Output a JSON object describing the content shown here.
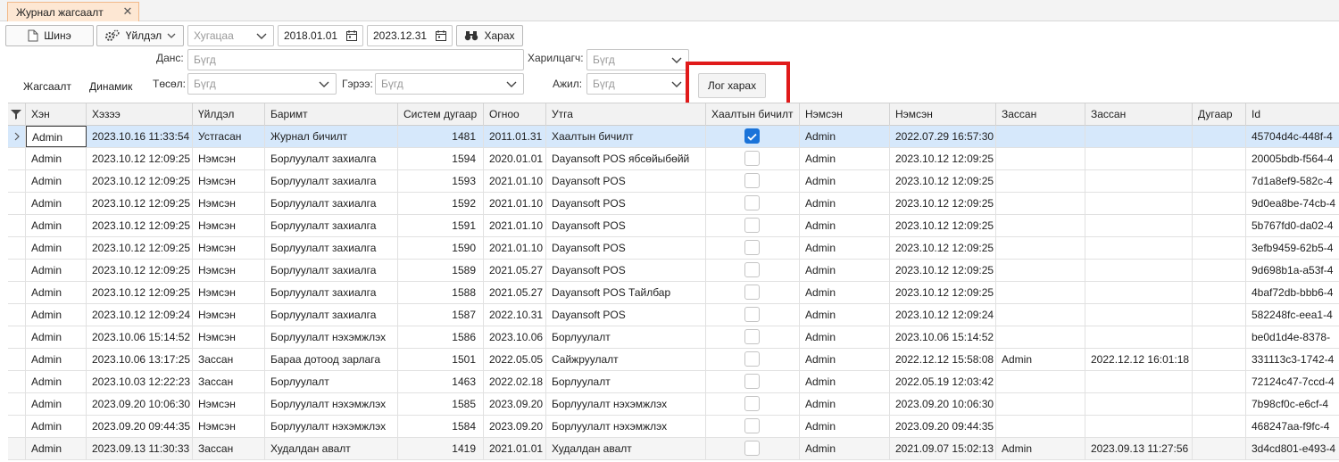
{
  "tab": {
    "title": "Журнал жагсаалт",
    "close": "✕"
  },
  "toolbar": {
    "new_label": "Шинэ",
    "action_label": "Үйлдэл",
    "period_placeholder": "Хугацаа",
    "date_from": "2018.01.01",
    "date_to": "2023.12.31",
    "view_label": "Харах"
  },
  "filters": {
    "account_label": "Данс:",
    "account_placeholder": "Бүгд",
    "partner_label": "Харилцагч:",
    "partner_placeholder": "Бүгд",
    "type_label": "Төсөл:",
    "type_placeholder": "Бүгд",
    "contract_label": "Гэрээ:",
    "contract_placeholder": "Бүгд",
    "job_label": "Ажил:",
    "job_placeholder": "Бүгд",
    "log_view_label": "Лог харах"
  },
  "view_tabs": {
    "list": "Жагсаалт",
    "dynamic": "Динамик"
  },
  "grid": {
    "columns": [
      "Хэн",
      "Хэзээ",
      "Үйлдэл",
      "Баримт",
      "Систем дугаар",
      "Огноо",
      "Утга",
      "Хаалтын бичилт",
      "Нэмсэн",
      "Нэмсэн",
      "Зассан",
      "Зассан",
      "Дугаар",
      "Id"
    ],
    "rows": [
      [
        "Admin",
        "2023.10.16 11:33:54",
        "Устгасан",
        "Журнал бичилт",
        "1481",
        "2011.01.31",
        "Хаалтын бичилт",
        true,
        "Admin",
        "2022.07.29 16:57:30",
        "",
        "",
        "",
        "45704d4c-448f-4"
      ],
      [
        "Admin",
        "2023.10.12 12:09:25",
        "Нэмсэн",
        "Борлуулалт захиалга",
        "1594",
        "2020.01.01",
        "Dayansoft POS ябсөйыбөйй",
        false,
        "Admin",
        "2023.10.12 12:09:25",
        "",
        "",
        "",
        "20005bdb-f564-4"
      ],
      [
        "Admin",
        "2023.10.12 12:09:25",
        "Нэмсэн",
        "Борлуулалт захиалга",
        "1593",
        "2021.01.10",
        "Dayansoft POS",
        false,
        "Admin",
        "2023.10.12 12:09:25",
        "",
        "",
        "",
        "7d1a8ef9-582c-4"
      ],
      [
        "Admin",
        "2023.10.12 12:09:25",
        "Нэмсэн",
        "Борлуулалт захиалга",
        "1592",
        "2021.01.10",
        "Dayansoft POS",
        false,
        "Admin",
        "2023.10.12 12:09:25",
        "",
        "",
        "",
        "9d0ea8be-74cb-4"
      ],
      [
        "Admin",
        "2023.10.12 12:09:25",
        "Нэмсэн",
        "Борлуулалт захиалга",
        "1591",
        "2021.01.10",
        "Dayansoft POS",
        false,
        "Admin",
        "2023.10.12 12:09:25",
        "",
        "",
        "",
        "5b767fd0-da02-4"
      ],
      [
        "Admin",
        "2023.10.12 12:09:25",
        "Нэмсэн",
        "Борлуулалт захиалга",
        "1590",
        "2021.01.10",
        "Dayansoft POS",
        false,
        "Admin",
        "2023.10.12 12:09:25",
        "",
        "",
        "",
        "3efb9459-62b5-4"
      ],
      [
        "Admin",
        "2023.10.12 12:09:25",
        "Нэмсэн",
        "Борлуулалт захиалга",
        "1589",
        "2021.05.27",
        "Dayansoft POS",
        false,
        "Admin",
        "2023.10.12 12:09:25",
        "",
        "",
        "",
        "9d698b1a-a53f-4"
      ],
      [
        "Admin",
        "2023.10.12 12:09:25",
        "Нэмсэн",
        "Борлуулалт захиалга",
        "1588",
        "2021.05.27",
        "Dayansoft POS Тайлбар",
        false,
        "Admin",
        "2023.10.12 12:09:25",
        "",
        "",
        "",
        "4baf72db-bbb6-4"
      ],
      [
        "Admin",
        "2023.10.12 12:09:24",
        "Нэмсэн",
        "Борлуулалт захиалга",
        "1587",
        "2022.10.31",
        "Dayansoft POS",
        false,
        "Admin",
        "2023.10.12 12:09:24",
        "",
        "",
        "",
        "582248fc-eea1-4"
      ],
      [
        "Admin",
        "2023.10.06 15:14:52",
        "Нэмсэн",
        "Борлуулалт нэхэмжлэх",
        "1586",
        "2023.10.06",
        "Борлуулалт",
        false,
        "Admin",
        "2023.10.06 15:14:52",
        "",
        "",
        "",
        "be0d1d4e-8378-"
      ],
      [
        "Admin",
        "2023.10.06 13:17:25",
        "Зассан",
        "Бараа дотоод зарлага",
        "1501",
        "2022.05.05",
        "Сайжруулалт",
        false,
        "Admin",
        "2022.12.12 15:58:08",
        "Admin",
        "2022.12.12 16:01:18",
        "",
        "331113c3-1742-4"
      ],
      [
        "Admin",
        "2023.10.03 12:22:23",
        "Зассан",
        "Борлуулалт",
        "1463",
        "2022.02.18",
        "Борлуулалт",
        false,
        "Admin",
        "2022.05.19 12:03:42",
        "",
        "",
        "",
        "72124c47-7ccd-4"
      ],
      [
        "Admin",
        "2023.09.20 10:06:30",
        "Нэмсэн",
        "Борлуулалт нэхэмжлэх",
        "1585",
        "2023.09.20",
        "Борлуулалт нэхэмжлэх",
        false,
        "Admin",
        "2023.09.20 10:06:30",
        "",
        "",
        "",
        "7b98cf0c-e6cf-4"
      ],
      [
        "Admin",
        "2023.09.20 09:44:35",
        "Нэмсэн",
        "Борлуулалт нэхэмжлэх",
        "1584",
        "2023.09.20",
        "Борлуулалт нэхэмжлэх",
        false,
        "Admin",
        "2023.09.20 09:44:35",
        "",
        "",
        "",
        "468247aa-f9fc-4"
      ],
      [
        "Admin",
        "2023.09.13 11:30:33",
        "Зассан",
        "Худалдан авалт",
        "1419",
        "2021.01.01",
        "Худалдан авалт",
        false,
        "Admin",
        "2021.09.07 15:02:13",
        "Admin",
        "2023.09.13 11:27:56",
        "",
        "3d4cd801-e493-4"
      ]
    ]
  },
  "colors": {
    "accent": "#1a73d9",
    "highlight": "#e01a1a",
    "selected_row": "#d6e8fb",
    "tab_bg": "#fde7d3"
  }
}
